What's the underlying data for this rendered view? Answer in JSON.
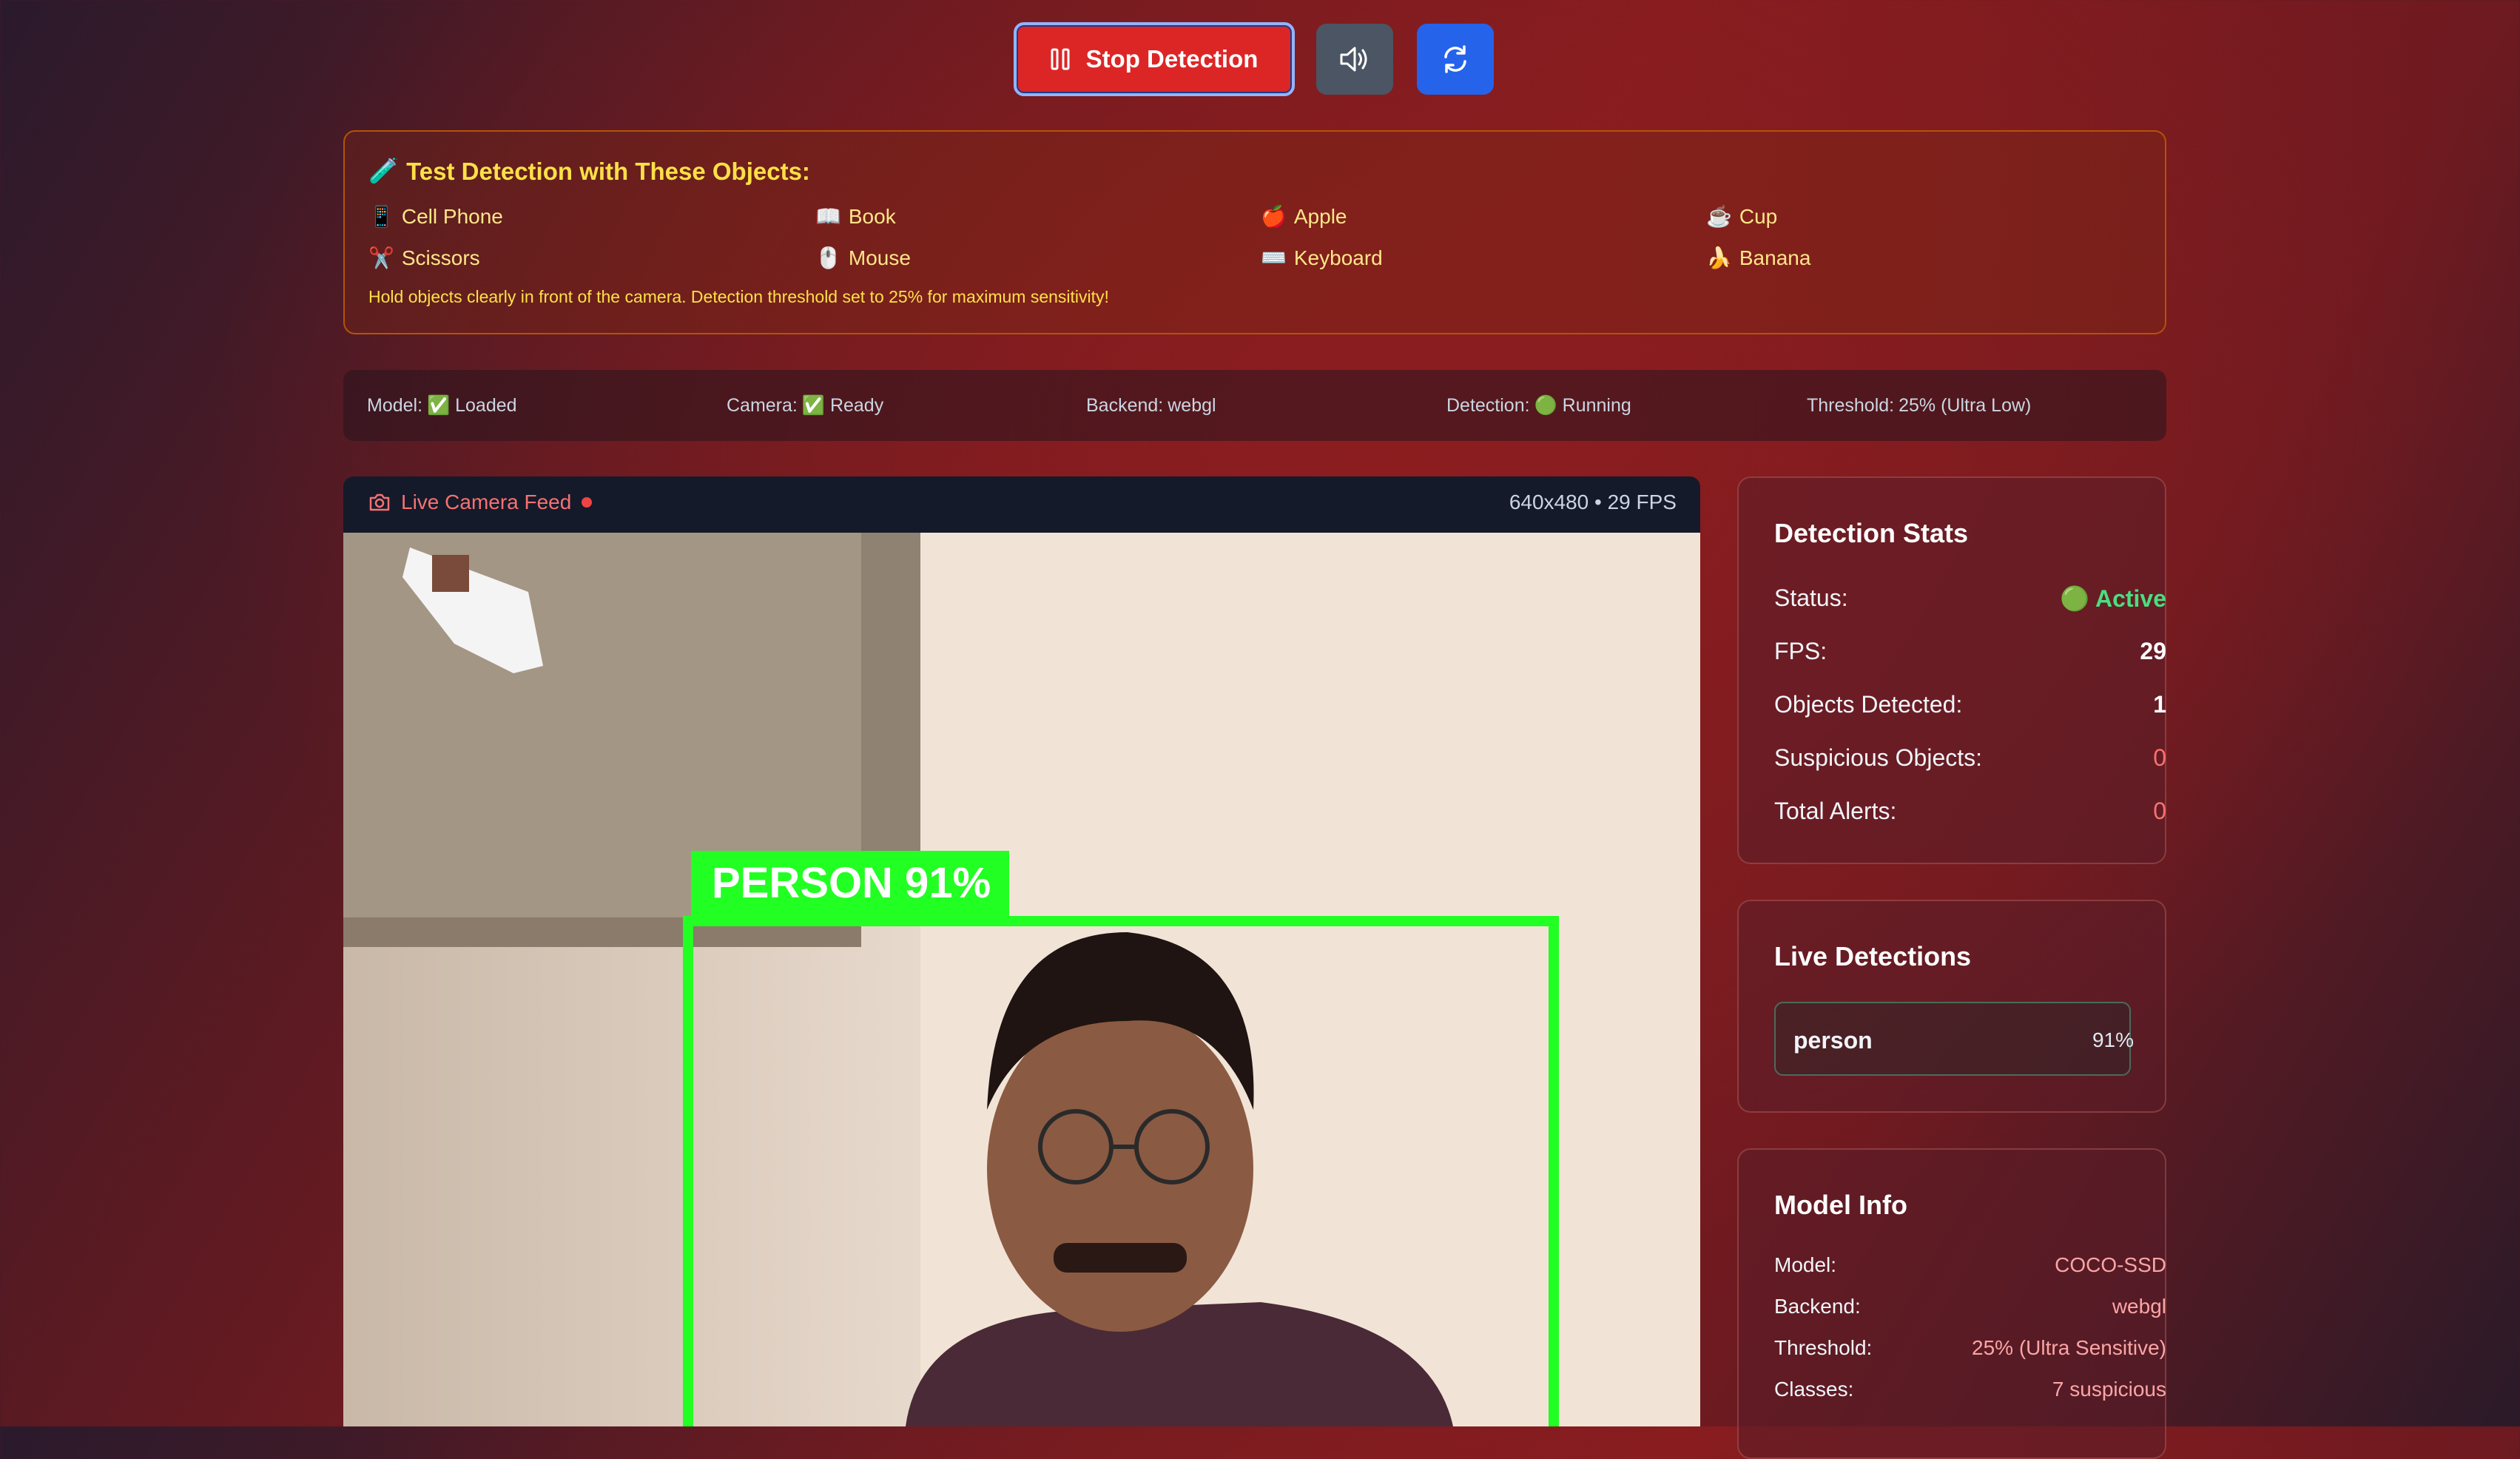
{
  "toolbar": {
    "stop_label": "Stop Detection"
  },
  "test_panel": {
    "title": "Test Detection with These Objects:",
    "objects": [
      {
        "icon": "📱",
        "label": "Cell Phone"
      },
      {
        "icon": "📖",
        "label": "Book"
      },
      {
        "icon": "🍎",
        "label": "Apple"
      },
      {
        "icon": "☕",
        "label": "Cup"
      },
      {
        "icon": "✂️",
        "label": "Scissors"
      },
      {
        "icon": "🖱️",
        "label": "Mouse"
      },
      {
        "icon": "⌨️",
        "label": "Keyboard"
      },
      {
        "icon": "🍌",
        "label": "Banana"
      }
    ],
    "hint": "Hold objects clearly in front of the camera. Detection threshold set to 25% for maximum sensitivity!"
  },
  "status_bar": {
    "model_label": "Model:",
    "model_value": "✅ Loaded",
    "camera_label": "Camera:",
    "camera_value": "✅ Ready",
    "backend_label": "Backend:",
    "backend_value": "webgl",
    "detection_label": "Detection:",
    "detection_value": "🟢 Running",
    "threshold_label": "Threshold:",
    "threshold_value": "25% (Ultra Low)"
  },
  "video": {
    "title": "Live Camera Feed",
    "info": "640x480 • 29 FPS",
    "box_label": "PERSON 91%"
  },
  "stats": {
    "title": "Detection Stats",
    "status_label": "Status:",
    "status_value": "🟢 Active",
    "fps_label": "FPS:",
    "fps_value": "29",
    "objects_label": "Objects Detected:",
    "objects_value": "1",
    "suspicious_label": "Suspicious Objects:",
    "suspicious_value": "0",
    "alerts_label": "Total Alerts:",
    "alerts_value": "0"
  },
  "live": {
    "title": "Live Detections",
    "items": [
      {
        "name": "person",
        "confidence": "91%"
      }
    ]
  },
  "model_info": {
    "title": "Model Info",
    "model_label": "Model:",
    "model_value": "COCO-SSD",
    "backend_label": "Backend:",
    "backend_value": "webgl",
    "threshold_label": "Threshold:",
    "threshold_value": "25% (Ultra Sensitive)",
    "classes_label": "Classes:",
    "classes_value": "7 suspicious"
  },
  "colors": {
    "stop": "#dc2626",
    "refresh": "#2563eb",
    "detection_box": "#22ff22",
    "accent_red": "#f87171"
  }
}
